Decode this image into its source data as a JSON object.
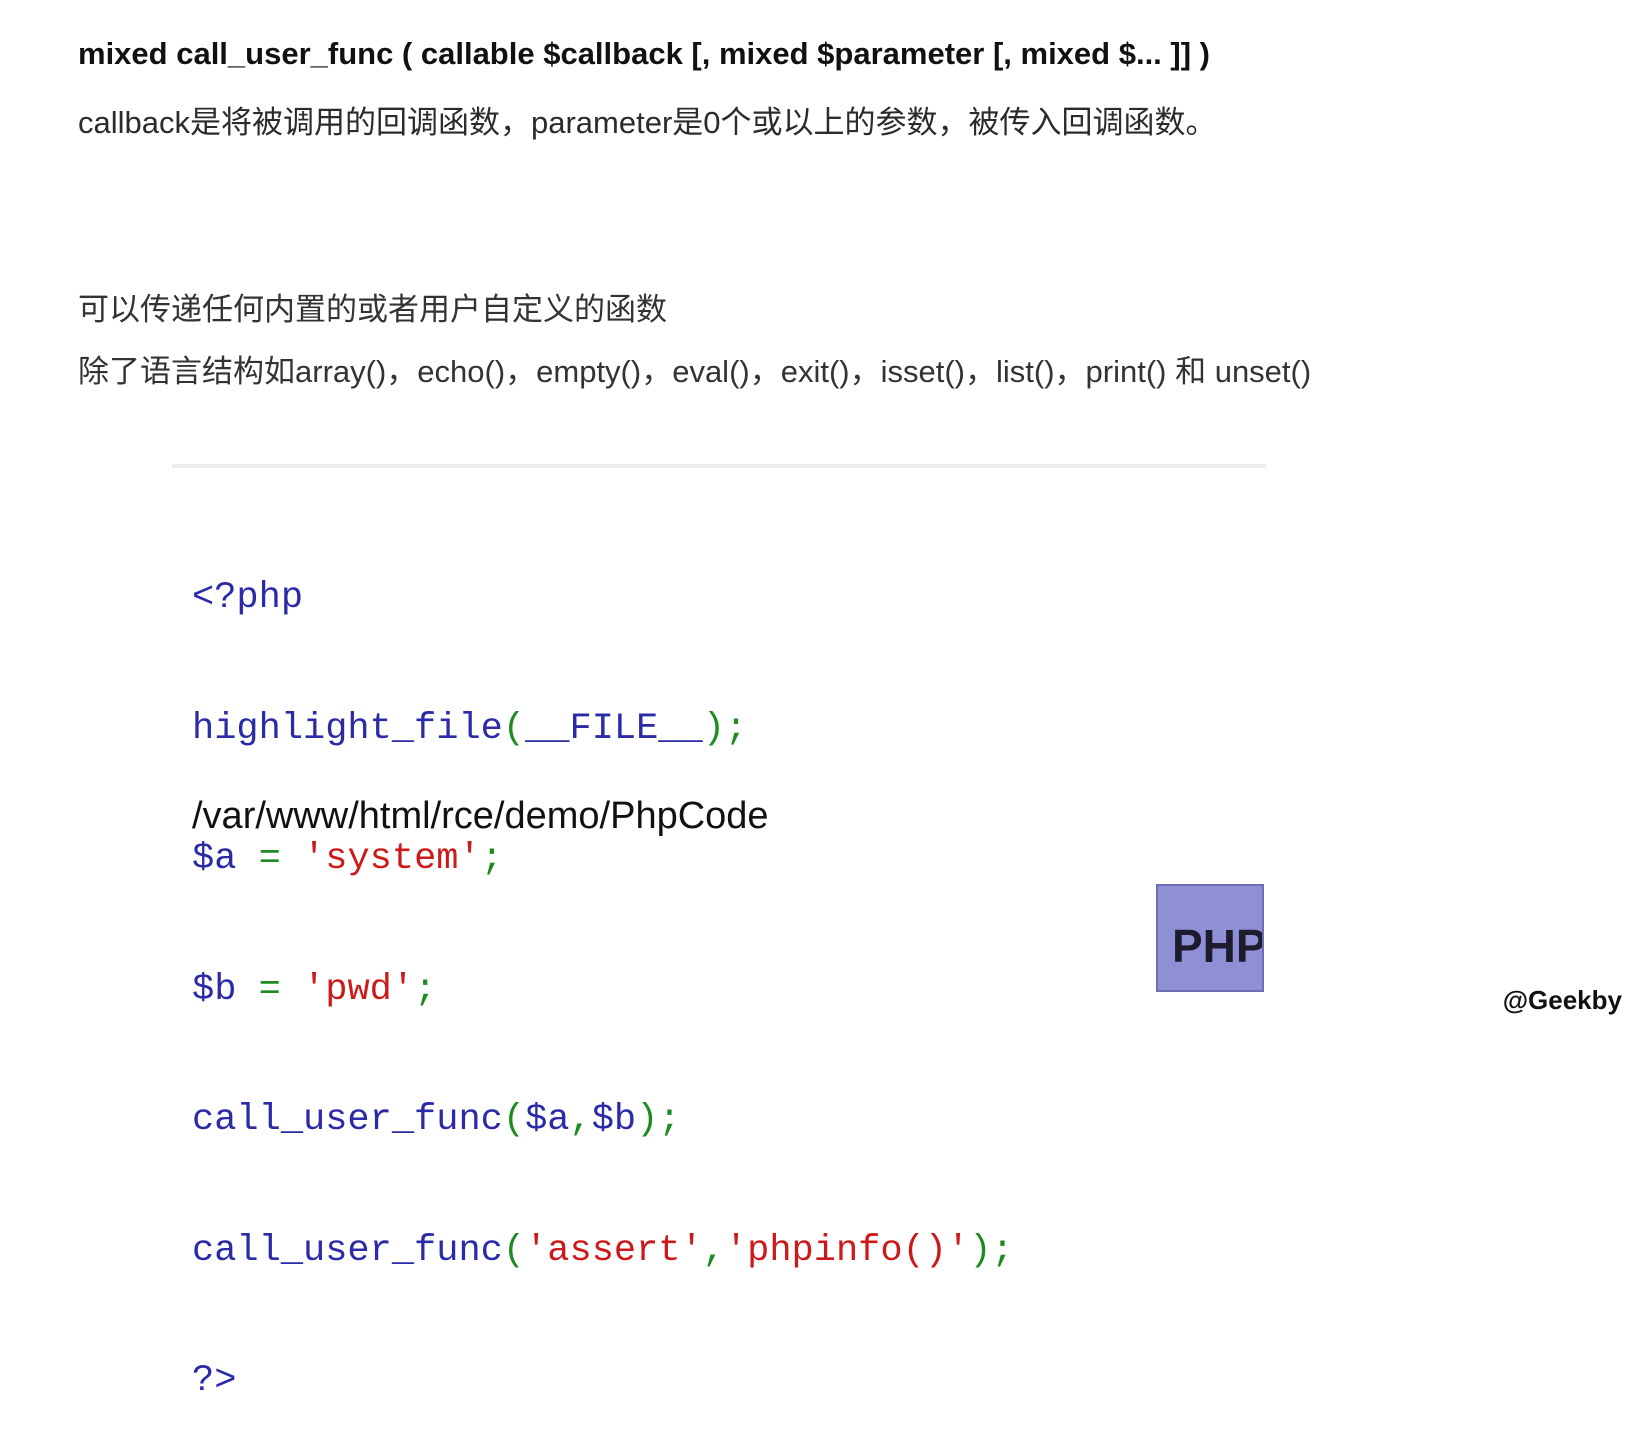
{
  "doc": {
    "signature": "mixed call_user_func ( callable $callback [, mixed $parameter [, mixed $... ]] )",
    "description": "callback是将被调用的回调函数，parameter是0个或以上的参数，被传入回调函数。",
    "note_1": "可以传递任何内置的或者用户自定义的函数",
    "note_2": "除了语言结构如array()，echo()，empty()，eval()，exit()，isset()，list()，print() 和 unset()"
  },
  "code": {
    "line1": {
      "open": "<?php"
    },
    "line2": {
      "fn": "highlight_file",
      "p1": "(",
      "arg": "__FILE__",
      "p2": ");"
    },
    "line3": {
      "var": "$a",
      "eq": " = ",
      "str": "'system'",
      "end": ";"
    },
    "line4": {
      "var": "$b",
      "eq": " = ",
      "str": "'pwd'",
      "end": ";"
    },
    "line5": {
      "fn": "call_user_func",
      "p1": "(",
      "arg1": "$a",
      "comma": ",",
      "arg2": "$b",
      "p2": ");"
    },
    "line6": {
      "fn": "call_user_func",
      "p1": "(",
      "str1": "'assert'",
      "comma": ",",
      "str2": "'phpinfo()'",
      "p2": ");"
    },
    "line7": {
      "close": "?>"
    }
  },
  "output": {
    "path": "/var/www/html/rce/demo/PhpCode"
  },
  "logo": {
    "text": "PHP",
    "icon": "php-logo-icon",
    "color": "#8f8fd6"
  },
  "watermark": "@Geekby",
  "colors": {
    "keyword": "#2b2ba8",
    "punctuation": "#1f8a1f",
    "string": "#cc1a1a"
  }
}
